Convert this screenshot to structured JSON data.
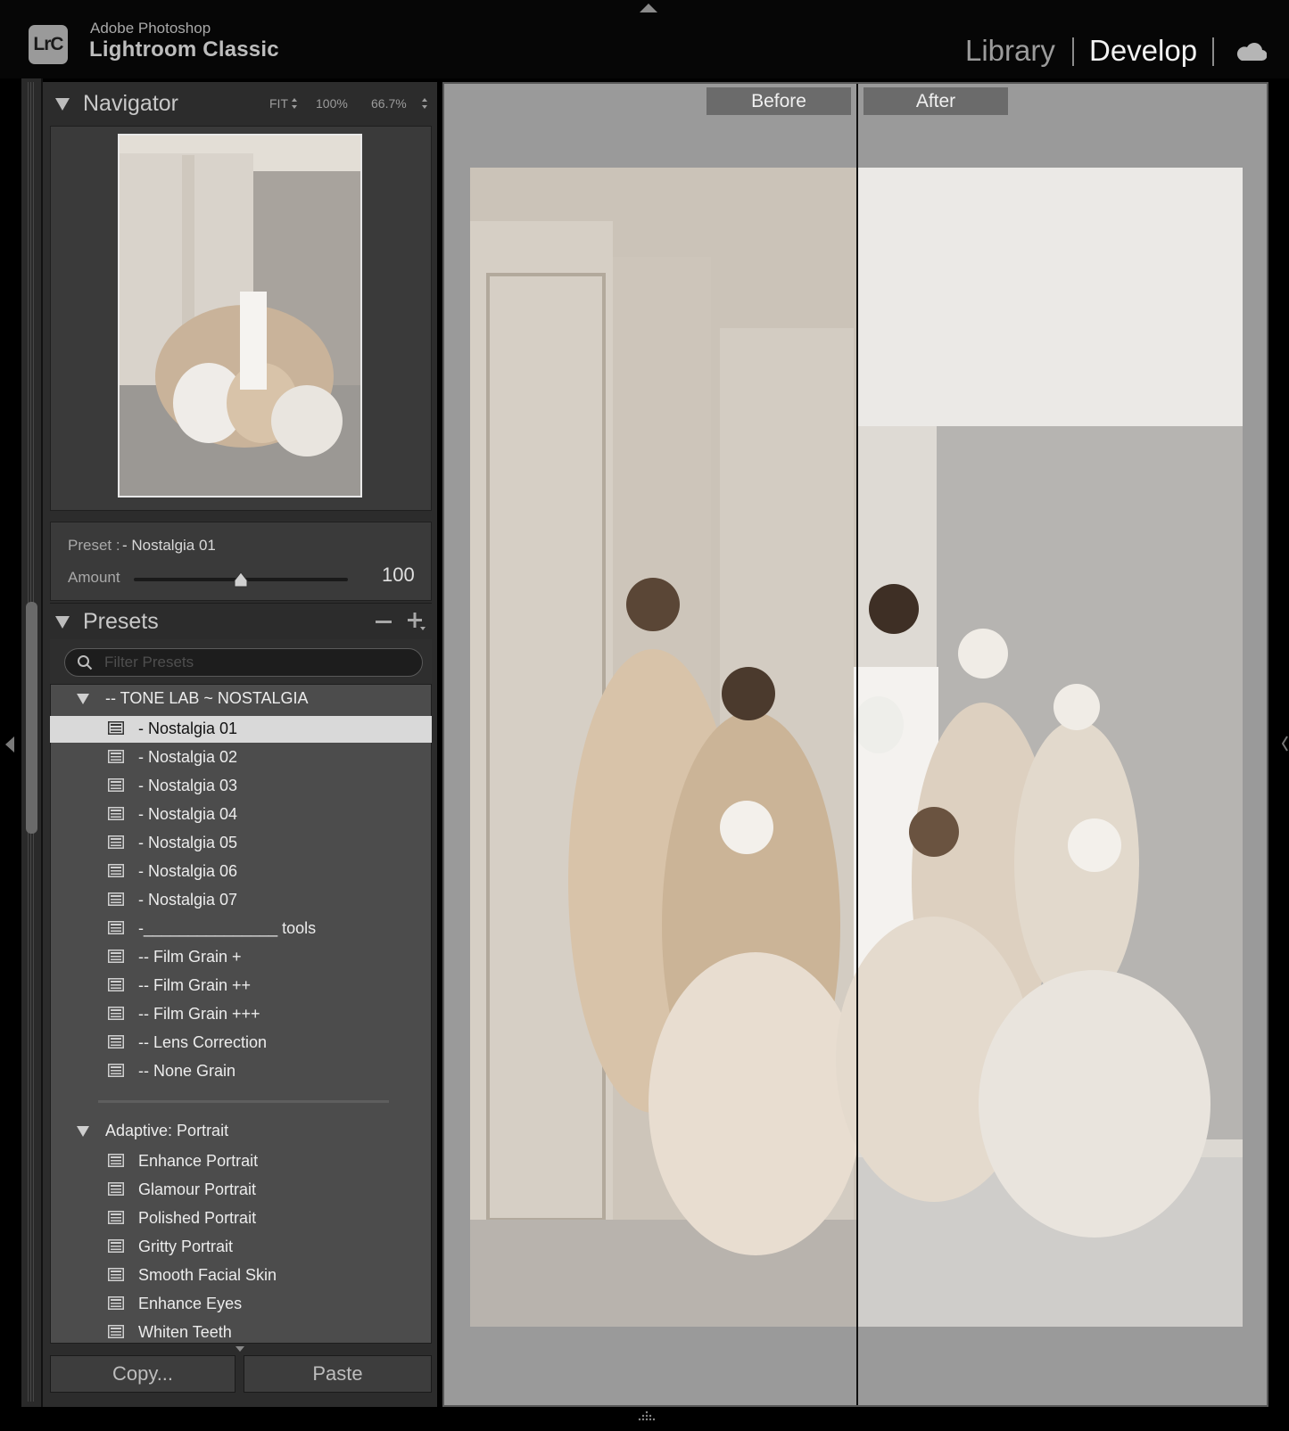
{
  "app": {
    "brand_line1": "Adobe Photoshop",
    "brand_line2": "Lightroom Classic",
    "logo_text": "LrC"
  },
  "modules": {
    "library": "Library",
    "develop": "Develop"
  },
  "navigator": {
    "title": "Navigator",
    "zoom_options": [
      "FIT",
      "100%",
      "66.7%"
    ]
  },
  "preset_applied": {
    "label": "Preset :",
    "name": "- Nostalgia 01",
    "amount_label": "Amount",
    "amount_value": "100",
    "amount_fraction": 0.5
  },
  "presets": {
    "title": "Presets",
    "filter_placeholder": "Filter Presets",
    "groups": [
      {
        "name": "-- TONE LAB ~ NOSTALGIA",
        "items": [
          "- Nostalgia 01",
          "- Nostalgia 02",
          "- Nostalgia 03",
          "- Nostalgia 04",
          "- Nostalgia 05",
          "- Nostalgia 06",
          "- Nostalgia 07",
          "-_______________ tools",
          "-- Film Grain +",
          "-- Film Grain ++",
          "-- Film Grain +++",
          "-- Lens Correction",
          "-- None Grain"
        ]
      },
      {
        "name": "Adaptive: Portrait",
        "items": [
          "Enhance Portrait",
          "Glamour Portrait",
          "Polished Portrait",
          "Gritty Portrait",
          "Smooth Facial Skin",
          "Enhance Eyes",
          "Whiten Teeth"
        ]
      }
    ],
    "selected": "- Nostalgia 01"
  },
  "buttons": {
    "copy": "Copy...",
    "paste": "Paste"
  },
  "view": {
    "before_label": "Before",
    "after_label": "After"
  }
}
